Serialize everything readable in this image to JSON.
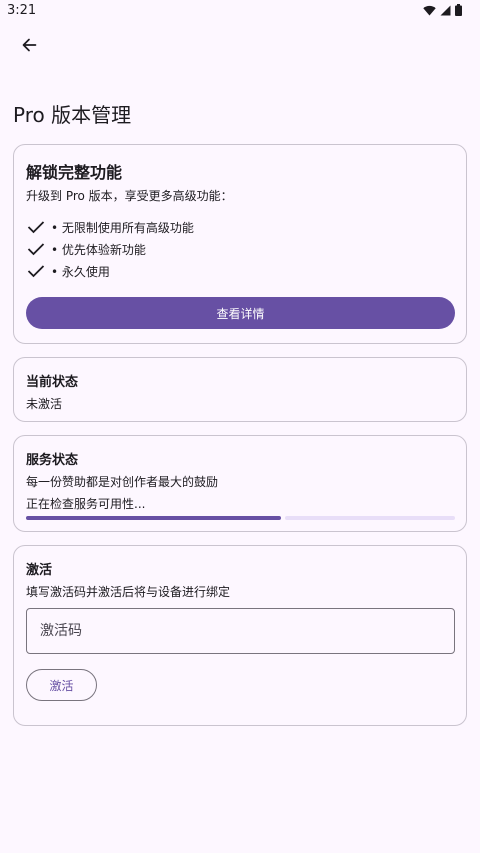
{
  "status_bar": {
    "time": "3:21",
    "icons": [
      "wifi-icon",
      "cell-signal-icon",
      "battery-icon"
    ]
  },
  "header": {
    "back_icon": "arrow-left-icon",
    "title": "Pro 版本管理"
  },
  "unlock_card": {
    "title": "解锁完整功能",
    "subtitle": "升级到 Pro 版本，享受更多高级功能：",
    "features": [
      {
        "icon": "check-icon",
        "text": "• 无限制使用所有高级功能"
      },
      {
        "icon": "check-icon",
        "text": "• 优先体验新功能"
      },
      {
        "icon": "check-icon",
        "text": "• 永久使用"
      }
    ],
    "details_button": "查看详情"
  },
  "status_card": {
    "title": "当前状态",
    "value": "未激活"
  },
  "service_card": {
    "title": "服务状态",
    "description": "每一份赞助都是对创作者最大的鼓励",
    "progress_text": "正在检查服务可用性...",
    "progress": 0.6
  },
  "activation_card": {
    "title": "激活",
    "description": "填写激活码并激活后将与设备进行绑定",
    "code_input": {
      "placeholder": "激活码",
      "value": ""
    },
    "activate_button": "激活"
  },
  "colors": {
    "background": "#fdf7ff",
    "primary": "#6750a4",
    "outline": "#cac4cf",
    "track": "#e8def8"
  }
}
